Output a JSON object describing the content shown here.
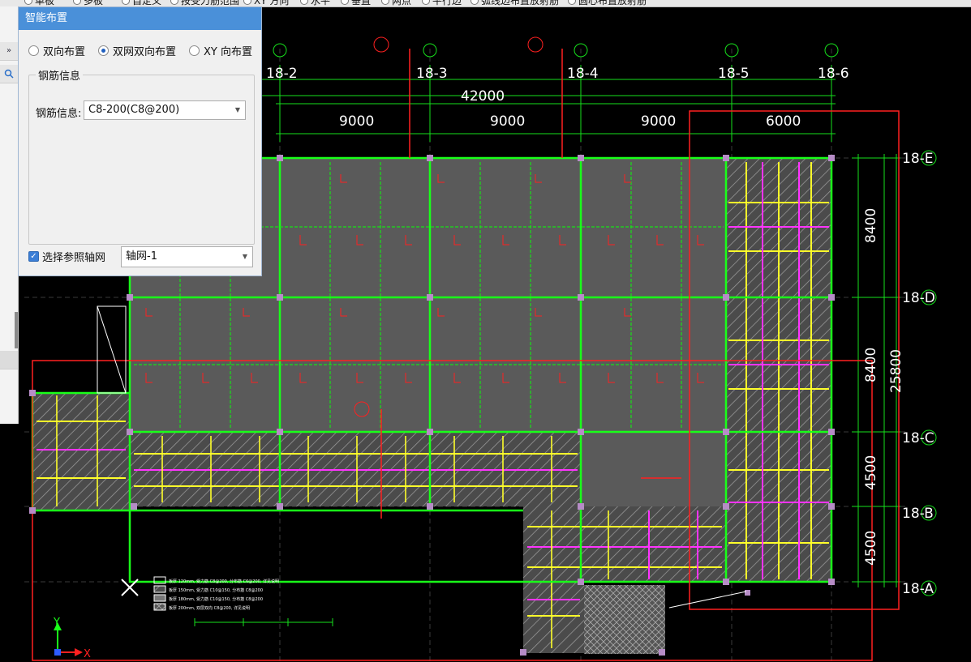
{
  "toolbar": {
    "options": [
      "单板",
      "多板",
      "自定义",
      "按受力筋范围",
      "XY 方向",
      "水平",
      "垂直",
      "两点",
      "平行边",
      "弧线边布置放射筋",
      "圆心布置放射筋"
    ]
  },
  "panel": {
    "title": "智能布置",
    "radios": [
      {
        "label": "双向布置",
        "selected": false
      },
      {
        "label": "双网双向布置",
        "selected": true
      },
      {
        "label": "XY 向布置",
        "selected": false
      }
    ],
    "group_title": "钢筋信息",
    "rebar_label": "钢筋信息:",
    "rebar_value": "C8-200(C8@200)",
    "ref_axis_label": "选择参照轴网",
    "ref_axis_checked": true,
    "axis_value": "轴网-1"
  },
  "left_strip": {
    "arrows": "»",
    "search_icon": "search-icon"
  },
  "drawing": {
    "col_axes": [
      "18-2",
      "18-3",
      "18-4",
      "18-5",
      "18-6"
    ],
    "row_axes": [
      "18-E",
      "18-D",
      "18-C",
      "18-B",
      "18-A"
    ],
    "total_width": "42000",
    "spans": [
      "9000",
      "9000",
      "9000",
      "6000"
    ],
    "row_spans": [
      "8400",
      "8400",
      "4500",
      "4500"
    ],
    "total_height": "25800",
    "x_axis_label": "X",
    "y_axis_label": "Y",
    "legend_lines": [
      "板厚 120mm, 受力筋 C8@200, 分布筋 C6@200, 详见说明",
      "板厚 150mm, 受力筋 C10@150, 分布筋 C8@200",
      "板厚 180mm, 受力筋 C10@150, 分布筋 C8@200",
      "板厚 200mm, 双层双向 C8@200, 详见说明"
    ],
    "colors": {
      "axis": "#16e01c",
      "beam": "#19ff19",
      "slab": "#5a5a5a",
      "rebar_y": "#ffff2a",
      "rebar_m": "#ff33ff",
      "red": "#ff2020",
      "white": "#ffffff"
    }
  }
}
